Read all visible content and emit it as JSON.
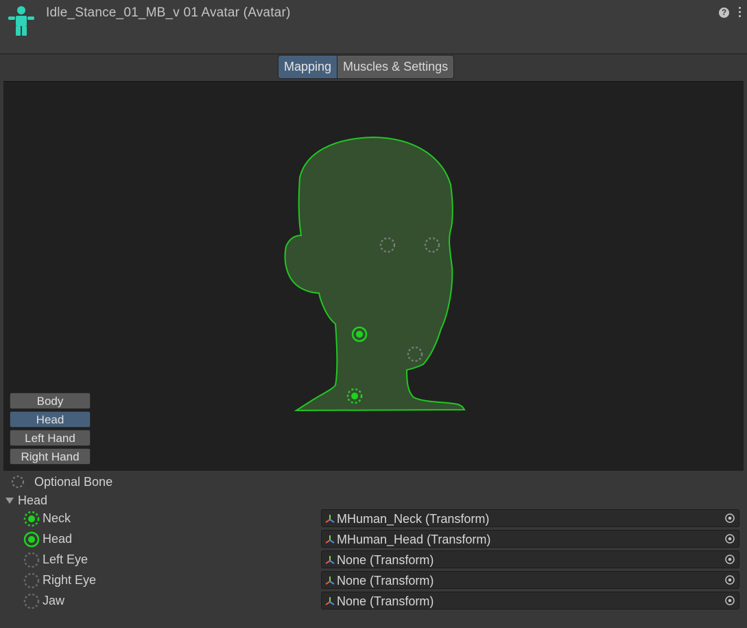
{
  "header": {
    "title": "Idle_Stance_01_MB_v 01 Avatar (Avatar)",
    "icon": "humanoid-avatar-icon",
    "accent_color": "#2fd3b5"
  },
  "tabs": [
    {
      "label": "Mapping",
      "active": true
    },
    {
      "label": "Muscles & Settings",
      "active": false
    }
  ],
  "body_parts": [
    {
      "label": "Body",
      "active": false
    },
    {
      "label": "Head",
      "active": true
    },
    {
      "label": "Left Hand",
      "active": false
    },
    {
      "label": "Right Hand",
      "active": false
    }
  ],
  "legend": {
    "optional_bone": "Optional Bone"
  },
  "section": {
    "label": "Head"
  },
  "bones": [
    {
      "label": "Neck",
      "value": "MHuman_Neck (Transform)",
      "state": "optional-mapped"
    },
    {
      "label": "Head",
      "value": "MHuman_Head (Transform)",
      "state": "required-mapped"
    },
    {
      "label": "Left Eye",
      "value": "None (Transform)",
      "state": "optional-empty"
    },
    {
      "label": "Right Eye",
      "value": "None (Transform)",
      "state": "optional-empty"
    },
    {
      "label": "Jaw",
      "value": "None (Transform)",
      "state": "optional-empty"
    }
  ],
  "colors": {
    "mapped": "#1fd21f",
    "head_fill": "#34502f",
    "head_outline": "#22c722",
    "empty": "#7a7a7a",
    "active_button": "#46607c"
  }
}
